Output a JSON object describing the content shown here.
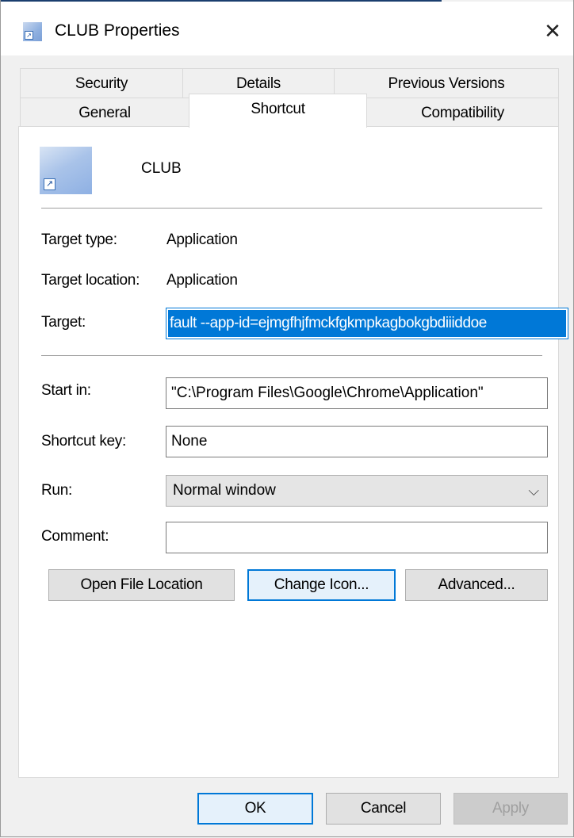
{
  "window": {
    "title": "CLUB Properties"
  },
  "tabs": {
    "row1": [
      "Security",
      "Details",
      "Previous Versions"
    ],
    "row2": [
      "General",
      "Shortcut",
      "Compatibility"
    ]
  },
  "shortcut": {
    "name": "CLUB",
    "target_type_label": "Target type:",
    "target_type_value": "Application",
    "target_location_label": "Target location:",
    "target_location_value": "Application",
    "target_label": "Target:",
    "target_value": "fault --app-id=ejmgfhjfmckfgkmpkagbokgbdiiiddoe",
    "start_in_label": "Start in:",
    "start_in_value": "\"C:\\Program Files\\Google\\Chrome\\Application\"",
    "shortcut_key_label": "Shortcut key:",
    "shortcut_key_value": "None",
    "run_label": "Run:",
    "run_value": "Normal window",
    "comment_label": "Comment:",
    "comment_value": ""
  },
  "actions": {
    "open_file_location": "Open File Location",
    "change_icon": "Change Icon...",
    "advanced": "Advanced..."
  },
  "dialog_buttons": {
    "ok": "OK",
    "cancel": "Cancel",
    "apply": "Apply"
  },
  "colors": {
    "accent": "#0078d7",
    "title_bar": "#ffffff",
    "panel": "#ffffff",
    "dialog_bg": "#f0f0f0"
  },
  "icons": {
    "close": "close-icon",
    "app": "app-shortcut-icon",
    "dropdown": "chevron-down-icon"
  }
}
